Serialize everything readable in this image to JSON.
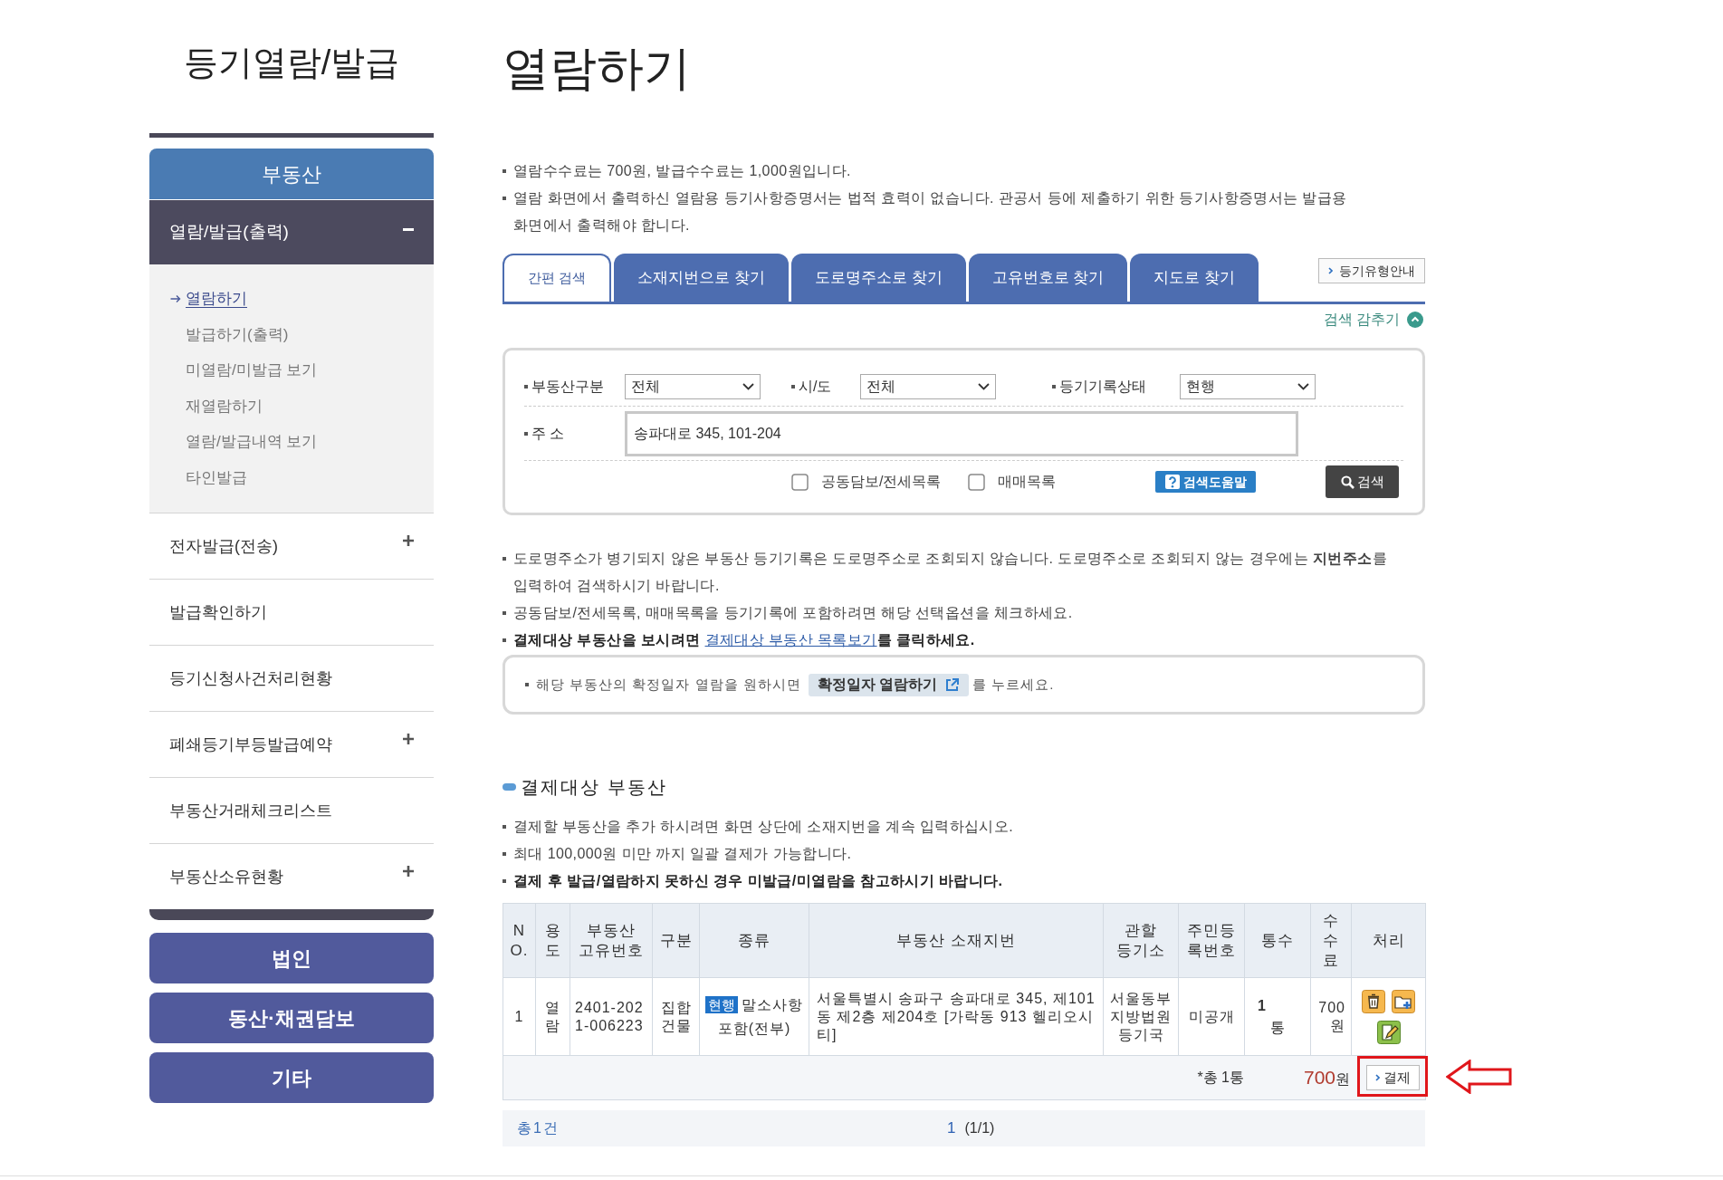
{
  "sidebar": {
    "title": "등기열람/발급",
    "categories": [
      {
        "label": "부동산",
        "selected": true,
        "menu": [
          {
            "label": "열람/발급(출력)",
            "expandable": true,
            "expanded": true,
            "children": [
              {
                "label": "열람하기",
                "selected": true
              },
              {
                "label": "발급하기(출력)",
                "selected": false
              },
              {
                "label": "미열람/미발급 보기",
                "selected": false
              },
              {
                "label": "재열람하기",
                "selected": false
              },
              {
                "label": "열람/발급내역 보기",
                "selected": false
              },
              {
                "label": "타인발급",
                "selected": false
              }
            ]
          },
          {
            "label": "전자발급(전송)",
            "expandable": true,
            "expanded": false
          },
          {
            "label": "발급확인하기",
            "expandable": false,
            "expanded": false
          },
          {
            "label": "등기신청사건처리현황",
            "expandable": false,
            "expanded": false
          },
          {
            "label": "폐쇄등기부등발급예약",
            "expandable": true,
            "expanded": false
          },
          {
            "label": "부동산거래체크리스트",
            "expandable": false,
            "expanded": false
          },
          {
            "label": "부동산소유현황",
            "expandable": true,
            "expanded": false
          }
        ]
      },
      {
        "label": "법인",
        "selected": false
      },
      {
        "label": "동산·채권담보",
        "selected": false
      },
      {
        "label": "기타",
        "selected": false
      }
    ]
  },
  "page_title": "열람하기",
  "notices": [
    {
      "text": "열람수수료는 700원, 발급수수료는 1,000원입니다.",
      "bold": false
    },
    {
      "text": "열람 화면에서 출력하신 열람용 등기사항증명서는 법적 효력이 없습니다. 관공서 등에 제출하기 위한 등기사항증명서는 발급용 화면에서 출력해야 합니다.",
      "bold": false
    }
  ],
  "tabs": [
    {
      "label": "간편 검색",
      "selected": true
    },
    {
      "label": "소재지번으로 찾기",
      "selected": false
    },
    {
      "label": "도로명주소로 찾기",
      "selected": false
    },
    {
      "label": "고유번호로 찾기",
      "selected": false
    },
    {
      "label": "지도로 찾기",
      "selected": false
    }
  ],
  "guide_button": "등기유형안내",
  "search_toggle": "검색 감추기",
  "search_form": {
    "selects": [
      {
        "label": "부동산구분",
        "value": "전체"
      },
      {
        "label": "시/도",
        "value": "전체"
      },
      {
        "label": "등기기록상태",
        "value": "현행"
      }
    ],
    "address": {
      "label": "주 소",
      "value": "송파대로 345, 101-204"
    },
    "options": [
      {
        "label": "공동담보/전세목록",
        "checked": false
      },
      {
        "label": "매매목록",
        "checked": false
      }
    ],
    "help_button": "검색도움말",
    "search_button": "검색"
  },
  "guide_notices": [
    {
      "text": "도로명주소가 병기되지 않은 부동산 등기기록은 도로명주소로 조회되지 않습니다. 도로명주소로 조회되지 않는 경우에는 **지번주소**를 입력하여 검색하시기 바랍니다.",
      "bold": false
    },
    {
      "text": "공동담보/전세목록, 매매목록을 등기기록에 포함하려면 해당 선택옵션을 체크하세요.",
      "bold": false
    },
    {
      "text": "결제대상 부동산을 보시려면",
      "link": "결제대상 부동산 목록보기",
      "after": "를 클릭하세요.",
      "bold": true
    }
  ],
  "confirm_box": {
    "text": "해당 부동산의 확정일자 열람을 원하시면",
    "button": "확정일자 열람하기",
    "after": "를 누르세요."
  },
  "payment": {
    "title": "결제대상 부동산",
    "notices": [
      {
        "text": "결제할 부동산을 추가 하시려면 화면 상단에 소재지번을 계속 입력하십시오.",
        "bold": false
      },
      {
        "text": "최대 100,000원 미만 까지 일괄 결제가 가능합니다.",
        "bold": false
      },
      {
        "text": "결제 후 발급/열람하지 못하신 경우 미발급/미열람을 참고하시기 바랍니다.",
        "bold": true
      }
    ],
    "table": {
      "columns": [
        "NO.",
        "용도",
        "부동산 고유번호",
        "구분",
        "종류",
        "부동산 소재지번",
        "관할 등기소",
        "주민등록번호",
        "통수",
        "수수료",
        "처리"
      ],
      "rows": [
        {
          "no": "1",
          "use": "열람",
          "unique_no": "2401-2021-006223",
          "division": "집합건물",
          "status": "현행",
          "kind": "말소사항포함(전부)",
          "address": "서울특별시 송파구 송파대로 345, 제101동 제2층 제204호 [가락동 913 헬리오시티]",
          "registry": "서울동부지방법원등기국",
          "resident_no": "미공개",
          "copies": "1",
          "copies_unit": "통",
          "fee": "700원"
        }
      ],
      "summary": {
        "count": "*총 1통",
        "amount": "700",
        "currency": "원",
        "pay_button": "결제"
      }
    },
    "pager": {
      "total": "총1건",
      "current": "1",
      "info": "(1/1)"
    }
  }
}
